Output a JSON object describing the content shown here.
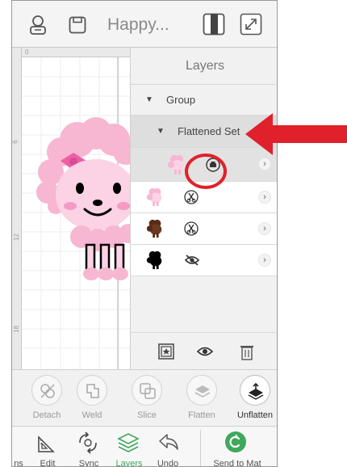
{
  "header": {
    "title": "Happy...",
    "icons": [
      "user-icon",
      "save-icon",
      "toggle-panel-icon",
      "expand-icon"
    ]
  },
  "canvas": {
    "ruler_top": [
      "0"
    ],
    "ruler_left": [
      "6",
      "12",
      "18"
    ]
  },
  "layers": {
    "title": "Layers",
    "group_label": "Group",
    "flattened_label": "Flattened Set",
    "rows": [
      {
        "thumb": "pink-poodle",
        "icon": "print-icon"
      },
      {
        "thumb": "pink-poodle",
        "icon": "scissors-icon"
      },
      {
        "thumb": "brown-poodle",
        "icon": "scissors-icon"
      },
      {
        "thumb": "black-poodle",
        "icon": "hidden-eye-icon"
      }
    ],
    "bottom_icons": [
      "group-icon",
      "eye-icon",
      "trash-icon"
    ]
  },
  "toolbar": {
    "items": [
      {
        "label": "Detach",
        "icon": "detach-icon"
      },
      {
        "label": "Weld",
        "icon": "weld-icon"
      },
      {
        "label": "Slice",
        "icon": "slice-icon"
      },
      {
        "label": "Flatten",
        "icon": "flatten-icon"
      },
      {
        "label": "Unflatten",
        "icon": "unflatten-icon"
      }
    ]
  },
  "nav": {
    "items": [
      {
        "label": "ns"
      },
      {
        "label": "Edit"
      },
      {
        "label": "Sync"
      },
      {
        "label": "Layers"
      },
      {
        "label": "Undo"
      },
      {
        "label": "Send to Mat"
      }
    ]
  },
  "colors": {
    "accent_green": "#3fa85c",
    "annotation_red": "#e0212b",
    "poodle_pink": "#f7b6d2",
    "poodle_hot_pink": "#ec5fa5"
  }
}
